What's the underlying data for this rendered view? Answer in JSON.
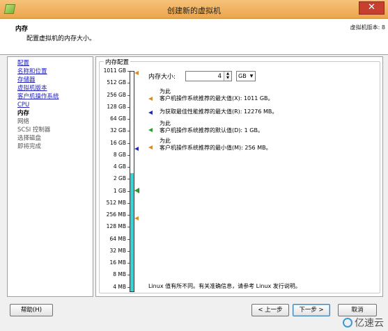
{
  "window": {
    "title": "创建新的虚拟机",
    "close": "✕"
  },
  "header": {
    "title": "内存",
    "subtitle": "配置虚拟机的内存大小。",
    "version": "虚拟机版本: 8"
  },
  "steps": [
    {
      "label": "配置",
      "state": "link"
    },
    {
      "label": "名称和位置",
      "state": "link"
    },
    {
      "label": "存储器",
      "state": "link"
    },
    {
      "label": "虚拟机版本",
      "state": "link"
    },
    {
      "label": "客户机操作系统",
      "state": "link"
    },
    {
      "label": "CPU",
      "state": "link"
    },
    {
      "label": "内存",
      "state": "current"
    },
    {
      "label": "网络",
      "state": "future"
    },
    {
      "label": "SCSI 控制器",
      "state": "future"
    },
    {
      "label": "选择磁盘",
      "state": "future"
    },
    {
      "label": "即将完成",
      "state": "future"
    }
  ],
  "memory": {
    "legend": "内存配置",
    "size_label": "内存大小:",
    "value": "4",
    "unit": "GB",
    "scale": [
      "1011 GB",
      "512 GB",
      "256 GB",
      "128 GB",
      "64 GB",
      "32 GB",
      "16 GB",
      "8 GB",
      "4 GB",
      "2 GB",
      "1 GB",
      "512 MB",
      "256 MB",
      "128 MB",
      "64 MB",
      "32 MB",
      "16 MB",
      "8 MB",
      "4 MB"
    ],
    "notes": [
      {
        "line1": "为此",
        "line2": "客户机操作系统推荐的最大值(X): 1011 GB。",
        "color": "#d98a2a"
      },
      {
        "line1": "",
        "line2": "为获取最佳性能推荐的最大值(R): 12276 MB。",
        "color": "#1f2ab0"
      },
      {
        "line1": "为此",
        "line2": "客户机操作系统推荐的默认值(D): 1 GB。",
        "color": "#2aa02a"
      },
      {
        "line1": "为此",
        "line2": "客户机操作系统推荐的最小值(M): 256 MB。",
        "color": "#d98a2a"
      }
    ],
    "footer": "Linux 值有所不同。有关准确信息，请参考 Linux 发行说明。"
  },
  "buttons": {
    "help": "帮助(H)",
    "back": "< 上一步",
    "next": "下一步 >",
    "cancel": "取消"
  },
  "watermark": "亿速云"
}
